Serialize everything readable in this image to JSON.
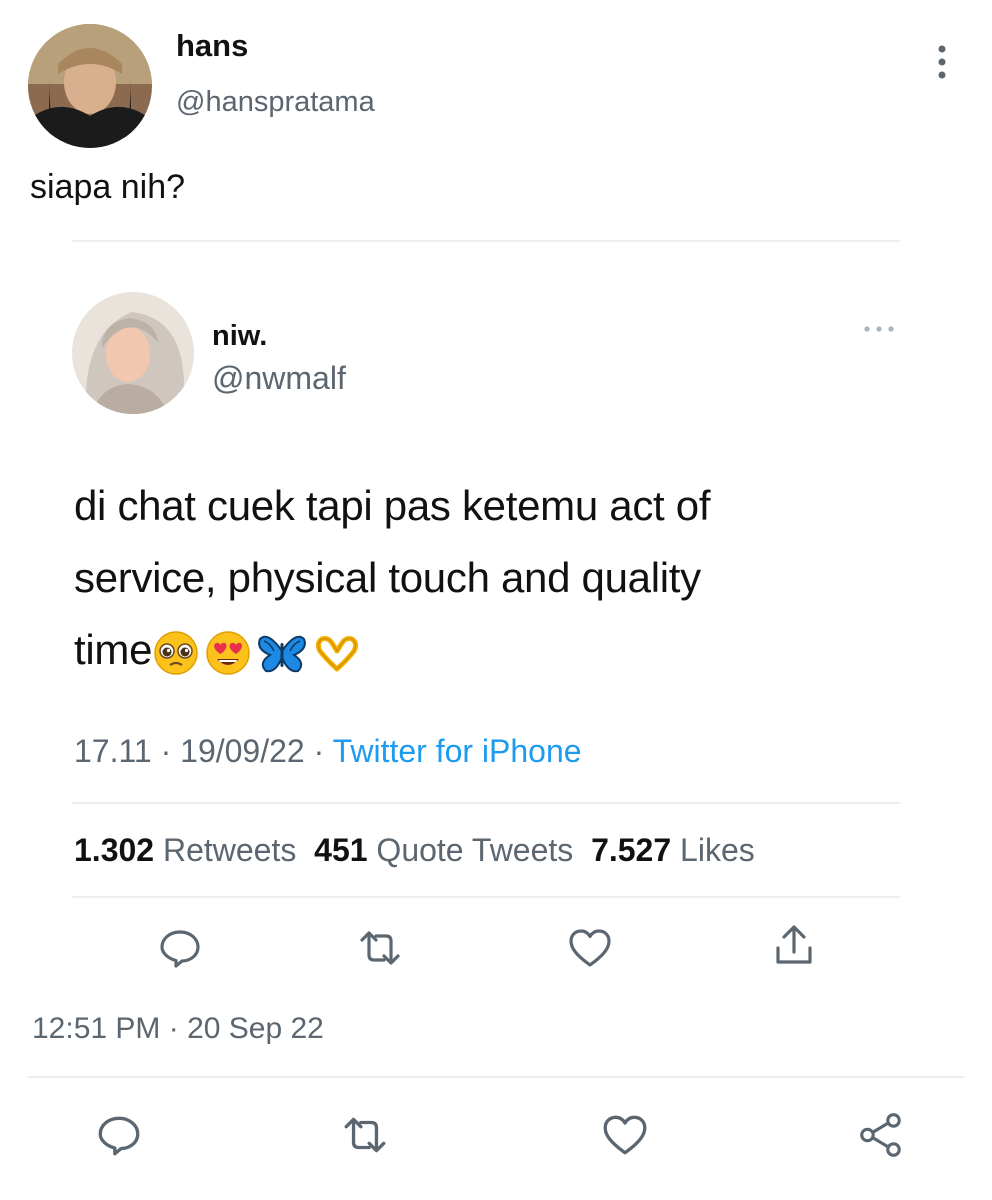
{
  "outer_tweet": {
    "author_name": "hans",
    "author_handle": "@hanspratama",
    "text": "siapa nih?",
    "timestamp": "12:51 PM · 20 Sep 22",
    "menu_icon": "more-vertical-icon"
  },
  "quoted_tweet": {
    "author_name": "niw.",
    "author_handle": "@nwmalf",
    "text_lines": [
      "di chat cuek tapi pas ketemu act of",
      "service, physical touch and quality",
      "time"
    ],
    "emojis": [
      "pleading-face-emoji",
      "heart-eyes-emoji",
      "butterfly-emoji",
      "heart-hands-emoji"
    ],
    "time": "17.11",
    "date": "19/09/22",
    "source": "Twitter for iPhone",
    "stats": {
      "retweets_count": "1.302",
      "retweets_label": "Retweets",
      "quotes_count": "451",
      "quotes_label": "Quote Tweets",
      "likes_count": "7.527",
      "likes_label": "Likes"
    },
    "menu_icon": "more-horizontal-icon"
  },
  "colors": {
    "text_primary": "#111111",
    "text_secondary": "#5b6670",
    "link": "#1d9bf0",
    "divider": "#eceff2"
  }
}
